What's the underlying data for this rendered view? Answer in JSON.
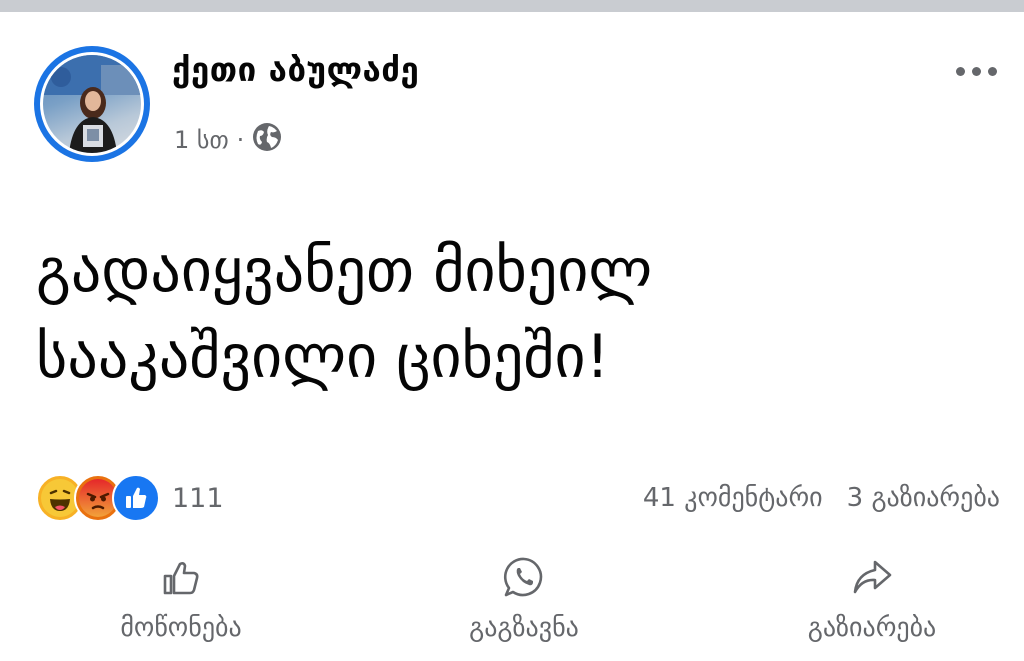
{
  "post": {
    "author": "ქეთი აბულაძე",
    "time": "1 სთ",
    "separator": "·",
    "audience_icon": "globe-icon",
    "text_line1": "გადაიყვანეთ მიხეილ",
    "text_line2": "სააკაშვილი ციხეში!"
  },
  "reactions": {
    "icons": [
      "haha-icon",
      "angry-icon",
      "like-icon"
    ],
    "count": "111",
    "comments": "41 კომენტარი",
    "shares": "3 გაზიარება"
  },
  "actions": [
    {
      "label": "მოწონება",
      "icon": "thumbs-up-icon"
    },
    {
      "label": "გაგზავნა",
      "icon": "whatsapp-icon"
    },
    {
      "label": "გაზიარება",
      "icon": "share-arrow-icon"
    }
  ],
  "colors": {
    "accent": "#1b74e4",
    "secondary_text": "#65676b",
    "haha": "#f7b125",
    "angry": "#e9710f",
    "like": "#1877f2"
  }
}
